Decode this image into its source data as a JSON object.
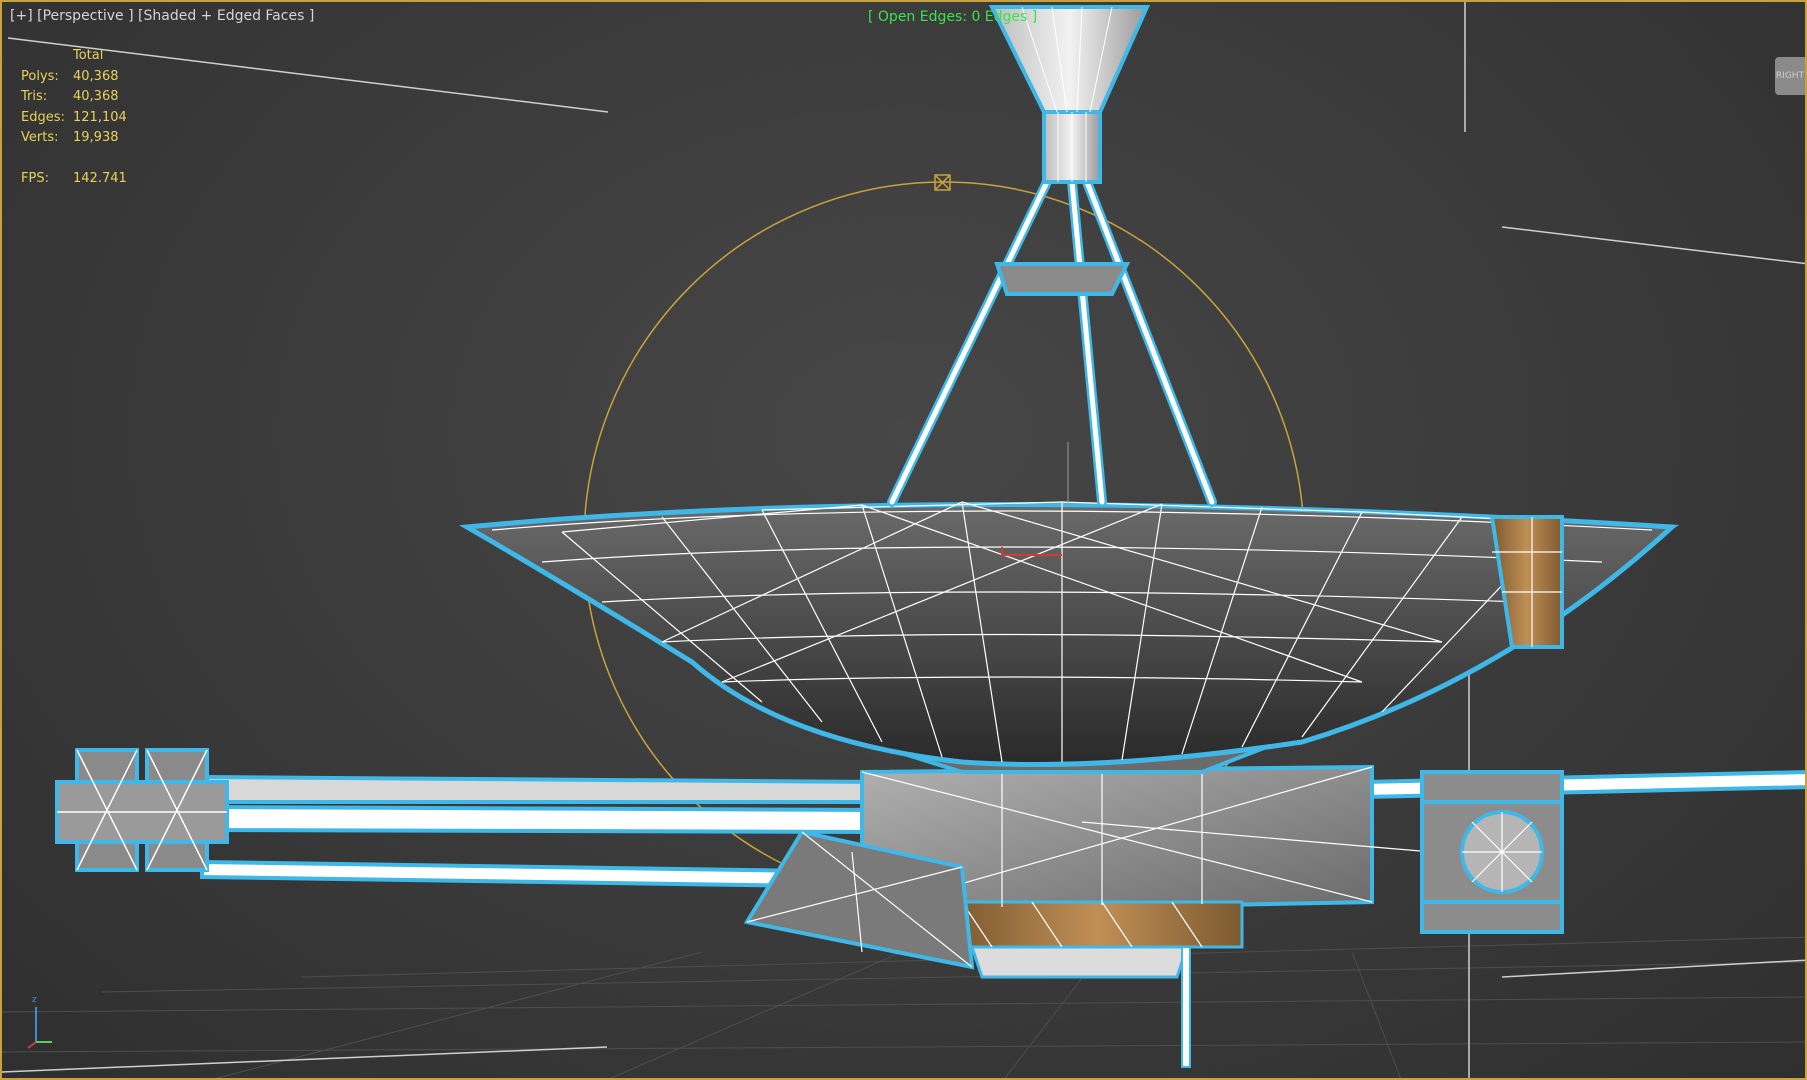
{
  "viewport": {
    "label_plus": "[+]",
    "label_view": "[Perspective ]",
    "label_shading": "[Shaded + Edged Faces ]",
    "open_edges": "[ Open Edges: 0 Edges ]"
  },
  "stats": {
    "header": "Total",
    "rows": [
      {
        "label": "Polys:",
        "value": "40,368"
      },
      {
        "label": "Tris:",
        "value": "40,368"
      },
      {
        "label": "Edges:",
        "value": "121,104"
      },
      {
        "label": "Verts:",
        "value": "19,938"
      }
    ],
    "fps_label": "FPS:",
    "fps_value": "142.741"
  },
  "nav_cube_label": "RIGHT",
  "axis_label": "z",
  "colors": {
    "border": "#c8a23c",
    "stats_text": "#e8d35a",
    "open_edges": "#39e34a",
    "selection_outline": "#3fb8e8",
    "gizmo_circle": "#c9a43a",
    "wire": "#ffffff",
    "gold_foil": "#a77b46"
  },
  "icons": {
    "model": "spacecraft-model",
    "gizmo": "selection-bounding-sphere"
  }
}
